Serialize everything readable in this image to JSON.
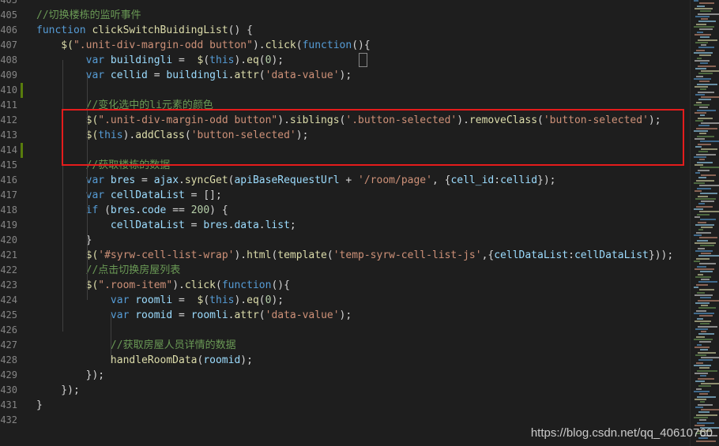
{
  "editor": {
    "lines": [
      {
        "no": "405",
        "tokens": []
      },
      {
        "no": "405",
        "tokens": [
          {
            "t": "//切换楼栋的监听事件",
            "c": "c"
          }
        ]
      },
      {
        "no": "406",
        "tokens": [
          {
            "t": "function ",
            "c": "k"
          },
          {
            "t": "clickSwitchBuidingList",
            "c": "f"
          },
          {
            "t": "() {",
            "c": "p"
          }
        ]
      },
      {
        "no": "407",
        "tokens": [
          {
            "t": "    $(",
            "c": "f"
          },
          {
            "t": "\".unit-div-margin-odd button\"",
            "c": "s"
          },
          {
            "t": ").",
            "c": "p"
          },
          {
            "t": "click",
            "c": "f"
          },
          {
            "t": "(",
            "c": "p"
          },
          {
            "t": "function",
            "c": "k"
          },
          {
            "t": "(){",
            "c": "p"
          }
        ]
      },
      {
        "no": "408",
        "tokens": [
          {
            "t": "        var ",
            "c": "k"
          },
          {
            "t": "buildingli",
            "c": "v"
          },
          {
            "t": " =  ",
            "c": "p"
          },
          {
            "t": "$",
            "c": "f"
          },
          {
            "t": "(",
            "c": "p"
          },
          {
            "t": "this",
            "c": "k"
          },
          {
            "t": ").",
            "c": "p"
          },
          {
            "t": "eq",
            "c": "f"
          },
          {
            "t": "(",
            "c": "p"
          },
          {
            "t": "0",
            "c": "n"
          },
          {
            "t": ");",
            "c": "p"
          }
        ]
      },
      {
        "no": "409",
        "tokens": [
          {
            "t": "        var ",
            "c": "k"
          },
          {
            "t": "cellid",
            "c": "v"
          },
          {
            "t": " = ",
            "c": "p"
          },
          {
            "t": "buildingli",
            "c": "v"
          },
          {
            "t": ".",
            "c": "p"
          },
          {
            "t": "attr",
            "c": "f"
          },
          {
            "t": "(",
            "c": "p"
          },
          {
            "t": "'data-value'",
            "c": "s"
          },
          {
            "t": ");",
            "c": "p"
          }
        ]
      },
      {
        "no": "410",
        "tokens": []
      },
      {
        "no": "411",
        "tokens": [
          {
            "t": "        //变化选中的li元素的颜色",
            "c": "c"
          }
        ]
      },
      {
        "no": "412",
        "tokens": [
          {
            "t": "        $(",
            "c": "f"
          },
          {
            "t": "\".unit-div-margin-odd button\"",
            "c": "s"
          },
          {
            "t": ").",
            "c": "p"
          },
          {
            "t": "siblings",
            "c": "f"
          },
          {
            "t": "(",
            "c": "p"
          },
          {
            "t": "'.button-selected'",
            "c": "s"
          },
          {
            "t": ").",
            "c": "p"
          },
          {
            "t": "removeClass",
            "c": "f"
          },
          {
            "t": "(",
            "c": "p"
          },
          {
            "t": "'button-selected'",
            "c": "s"
          },
          {
            "t": ");",
            "c": "p"
          }
        ]
      },
      {
        "no": "413",
        "tokens": [
          {
            "t": "        $(",
            "c": "f"
          },
          {
            "t": "this",
            "c": "k"
          },
          {
            "t": ").",
            "c": "p"
          },
          {
            "t": "addClass",
            "c": "f"
          },
          {
            "t": "(",
            "c": "p"
          },
          {
            "t": "'button-selected'",
            "c": "s"
          },
          {
            "t": ");",
            "c": "p"
          }
        ]
      },
      {
        "no": "414",
        "tokens": []
      },
      {
        "no": "415",
        "tokens": [
          {
            "t": "        //获取楼栋的数据",
            "c": "c"
          }
        ]
      },
      {
        "no": "416",
        "tokens": [
          {
            "t": "        var ",
            "c": "k"
          },
          {
            "t": "bres",
            "c": "v"
          },
          {
            "t": " = ",
            "c": "p"
          },
          {
            "t": "ajax",
            "c": "v"
          },
          {
            "t": ".",
            "c": "p"
          },
          {
            "t": "syncGet",
            "c": "f"
          },
          {
            "t": "(",
            "c": "p"
          },
          {
            "t": "apiBaseRequestUrl",
            "c": "v"
          },
          {
            "t": " + ",
            "c": "p"
          },
          {
            "t": "'/room/page'",
            "c": "s"
          },
          {
            "t": ", {",
            "c": "p"
          },
          {
            "t": "cell_id",
            "c": "v"
          },
          {
            "t": ":",
            "c": "p"
          },
          {
            "t": "cellid",
            "c": "v"
          },
          {
            "t": "});",
            "c": "p"
          }
        ]
      },
      {
        "no": "417",
        "tokens": [
          {
            "t": "        var ",
            "c": "k"
          },
          {
            "t": "cellDataList",
            "c": "v"
          },
          {
            "t": " = [];",
            "c": "p"
          }
        ]
      },
      {
        "no": "418",
        "tokens": [
          {
            "t": "        if ",
            "c": "k"
          },
          {
            "t": "(",
            "c": "p"
          },
          {
            "t": "bres",
            "c": "v"
          },
          {
            "t": ".",
            "c": "p"
          },
          {
            "t": "code",
            "c": "v"
          },
          {
            "t": " == ",
            "c": "p"
          },
          {
            "t": "200",
            "c": "n"
          },
          {
            "t": ") {",
            "c": "p"
          }
        ]
      },
      {
        "no": "419",
        "tokens": [
          {
            "t": "            cellDataList",
            "c": "v"
          },
          {
            "t": " = ",
            "c": "p"
          },
          {
            "t": "bres",
            "c": "v"
          },
          {
            "t": ".",
            "c": "p"
          },
          {
            "t": "data",
            "c": "v"
          },
          {
            "t": ".",
            "c": "p"
          },
          {
            "t": "list",
            "c": "v"
          },
          {
            "t": ";",
            "c": "p"
          }
        ]
      },
      {
        "no": "420",
        "tokens": [
          {
            "t": "        }",
            "c": "p"
          }
        ]
      },
      {
        "no": "421",
        "tokens": [
          {
            "t": "        $(",
            "c": "f"
          },
          {
            "t": "'#syrw-cell-list-wrap'",
            "c": "s"
          },
          {
            "t": ").",
            "c": "p"
          },
          {
            "t": "html",
            "c": "f"
          },
          {
            "t": "(",
            "c": "p"
          },
          {
            "t": "template",
            "c": "f"
          },
          {
            "t": "(",
            "c": "p"
          },
          {
            "t": "'temp-syrw-cell-list-js'",
            "c": "s"
          },
          {
            "t": ",{",
            "c": "p"
          },
          {
            "t": "cellDataList",
            "c": "v"
          },
          {
            "t": ":",
            "c": "p"
          },
          {
            "t": "cellDataList",
            "c": "v"
          },
          {
            "t": "}));",
            "c": "p"
          }
        ]
      },
      {
        "no": "422",
        "tokens": [
          {
            "t": "        //点击切换房屋列表",
            "c": "c"
          }
        ]
      },
      {
        "no": "423",
        "tokens": [
          {
            "t": "        $(",
            "c": "f"
          },
          {
            "t": "\".room-item\"",
            "c": "s"
          },
          {
            "t": ").",
            "c": "p"
          },
          {
            "t": "click",
            "c": "f"
          },
          {
            "t": "(",
            "c": "p"
          },
          {
            "t": "function",
            "c": "k"
          },
          {
            "t": "(){",
            "c": "p"
          }
        ]
      },
      {
        "no": "424",
        "tokens": [
          {
            "t": "            var ",
            "c": "k"
          },
          {
            "t": "roomli",
            "c": "v"
          },
          {
            "t": " =  ",
            "c": "p"
          },
          {
            "t": "$",
            "c": "f"
          },
          {
            "t": "(",
            "c": "p"
          },
          {
            "t": "this",
            "c": "k"
          },
          {
            "t": ").",
            "c": "p"
          },
          {
            "t": "eq",
            "c": "f"
          },
          {
            "t": "(",
            "c": "p"
          },
          {
            "t": "0",
            "c": "n"
          },
          {
            "t": ");",
            "c": "p"
          }
        ]
      },
      {
        "no": "425",
        "tokens": [
          {
            "t": "            var ",
            "c": "k"
          },
          {
            "t": "roomid",
            "c": "v"
          },
          {
            "t": " = ",
            "c": "p"
          },
          {
            "t": "roomli",
            "c": "v"
          },
          {
            "t": ".",
            "c": "p"
          },
          {
            "t": "attr",
            "c": "f"
          },
          {
            "t": "(",
            "c": "p"
          },
          {
            "t": "'data-value'",
            "c": "s"
          },
          {
            "t": ");",
            "c": "p"
          }
        ]
      },
      {
        "no": "426",
        "tokens": []
      },
      {
        "no": "427",
        "tokens": [
          {
            "t": "            //获取房屋人员详情的数据",
            "c": "c"
          }
        ]
      },
      {
        "no": "428",
        "tokens": [
          {
            "t": "            handleRoomData",
            "c": "f"
          },
          {
            "t": "(",
            "c": "p"
          },
          {
            "t": "roomid",
            "c": "v"
          },
          {
            "t": ");",
            "c": "p"
          }
        ]
      },
      {
        "no": "429",
        "tokens": [
          {
            "t": "        });",
            "c": "p"
          }
        ]
      },
      {
        "no": "430",
        "tokens": [
          {
            "t": "    });",
            "c": "p"
          }
        ]
      },
      {
        "no": "431",
        "tokens": [
          {
            "t": "}",
            "c": "p"
          }
        ]
      },
      {
        "no": "432",
        "tokens": []
      }
    ]
  },
  "colors": {
    "background": "#1e1e1e",
    "keyword": "#569cd6",
    "string": "#ce9178",
    "function": "#dcdcaa",
    "variable": "#9cdcfe",
    "number": "#b5cea8",
    "comment": "#6a9955",
    "highlight_border": "#e51c1c"
  },
  "watermark": "https://blog.csdn.net/qq_40610760"
}
